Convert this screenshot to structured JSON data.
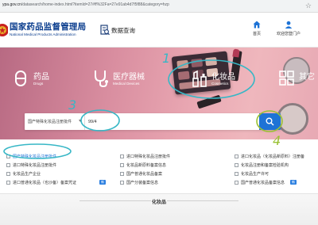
{
  "browser": {
    "url": "ypa.gov.cn/datasearch/home-index.html?itemId=27#ff%32Fa=27e91ab4d7f5f88&category=hzp",
    "url_domain": "ypa.gov.cn",
    "url_path": "/datasearch/home-index.html?itemId=27#ff%32Fa=27e91ab4d7f5f88&category=hzp"
  },
  "header": {
    "logo_cn": "国家药品监督管理局",
    "logo_en": "National Medical Products Administration",
    "data_query": "数据查询",
    "nav_home": "首页",
    "nav_user": "欢迎您登门户"
  },
  "banner": {
    "categories": [
      {
        "cn": "药品",
        "en": "Drugs"
      },
      {
        "cn": "医疗器械",
        "en": "Medical Devices"
      },
      {
        "cn": "化妆品",
        "en": "Cosmetics"
      },
      {
        "cn": "其它",
        "en": ""
      }
    ]
  },
  "search": {
    "select_value": "国产特殊化妆品注册批件",
    "input_value": "99/4"
  },
  "links": {
    "col1": [
      {
        "text": "国产特殊化妆品注册批件",
        "active": true,
        "tag": ""
      },
      {
        "text": "进口特殊化妆品注册批件",
        "active": false,
        "tag": ""
      },
      {
        "text": "化妆品生产企业",
        "active": false,
        "tag": ""
      },
      {
        "text": "进口普通化妆品（也沙备）备案凭证",
        "active": false,
        "tag": "新"
      }
    ],
    "col2": [
      {
        "text": "进口特殊化妆品注册批件",
        "active": false,
        "tag": ""
      },
      {
        "text": "化妆品新原料备案信息",
        "active": false,
        "tag": ""
      },
      {
        "text": "国产普通化妆品备案",
        "active": false,
        "tag": ""
      },
      {
        "text": "国产分装备案信息",
        "active": false,
        "tag": ""
      }
    ],
    "col3": [
      {
        "text": "进口化妆品（化妆品新原料）注册备",
        "active": false,
        "tag": ""
      },
      {
        "text": "化妆品注册和备案检验机构",
        "active": false,
        "tag": ""
      },
      {
        "text": "化妆品生产许可",
        "active": false,
        "tag": ""
      },
      {
        "text": "国产普通化妆品备案信息",
        "active": false,
        "tag": "新"
      }
    ]
  },
  "footer": {
    "title": "化妆品"
  },
  "annotations": [
    "1",
    "3",
    "4"
  ],
  "colors": {
    "brand_blue": "#0d3f8f",
    "accent_blue": "#1e73d6",
    "annotation_cyan": "#37b7c6",
    "annotation_green": "#9ac133"
  }
}
